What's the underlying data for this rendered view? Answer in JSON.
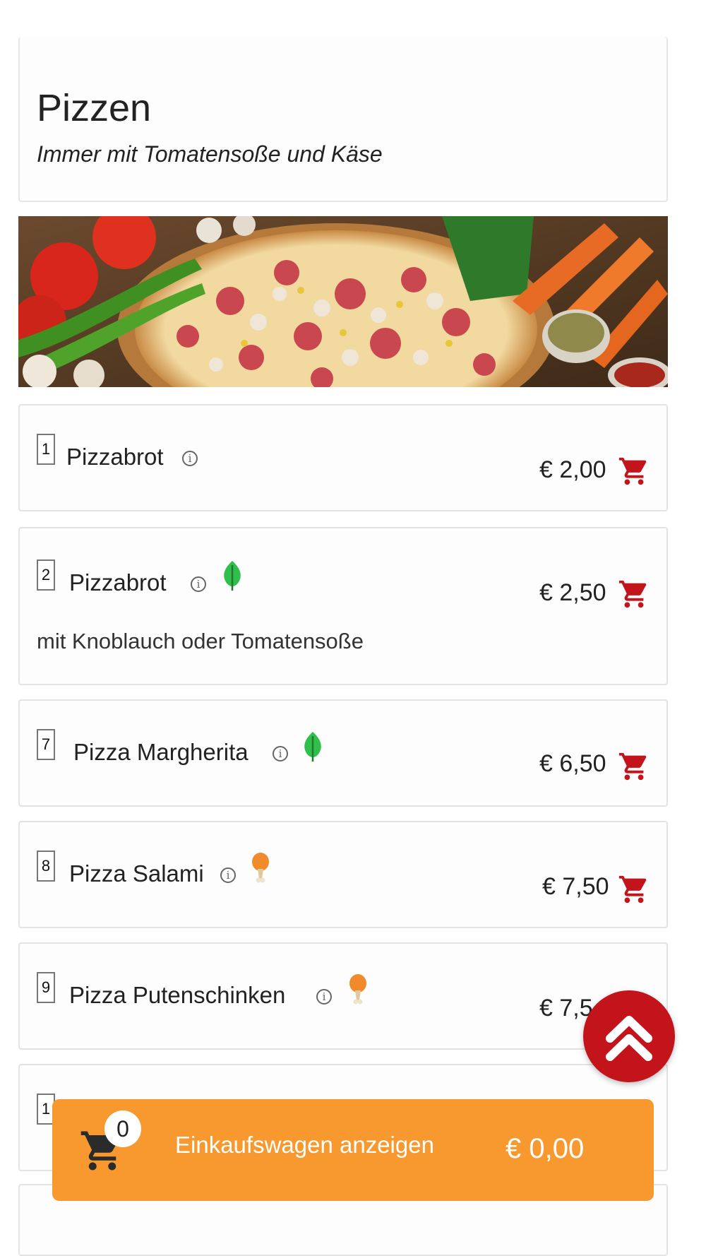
{
  "category": {
    "title": "Pizzen",
    "subtitle": "Immer mit Tomatensoße und Käse"
  },
  "banner": {
    "image": "pizza-with-vegetables-photo"
  },
  "items": [
    {
      "number": "1",
      "name": "Pizzabrot",
      "description": "",
      "diet_icon": "",
      "price": "€ 2,00"
    },
    {
      "number": "2",
      "name": "Pizzabrot",
      "description": "mit Knoblauch oder Tomatensoße",
      "diet_icon": "leaf-icon",
      "price": "€ 2,50"
    },
    {
      "number": "7",
      "name": "Pizza Margherita",
      "description": "",
      "diet_icon": "leaf-icon",
      "price": "€ 6,50"
    },
    {
      "number": "8",
      "name": "Pizza Salami",
      "description": "",
      "diet_icon": "drumstick-icon",
      "price": "€ 7,50"
    },
    {
      "number": "9",
      "name": "Pizza Putenschinken",
      "description": "",
      "diet_icon": "drumstick-icon",
      "price": "€ 7,5"
    },
    {
      "number": "1",
      "name": "",
      "description": "",
      "diet_icon": "",
      "price": ""
    }
  ],
  "cart": {
    "count": "0",
    "label": "Einkaufswagen anzeigen",
    "total": "€ 0,00"
  },
  "colors": {
    "accent_red": "#c4141b",
    "cart_orange": "#f7992e",
    "leaf_green": "#2fbf4a",
    "drumstick_orange": "#f08a2a"
  },
  "icons": {
    "info": "i",
    "scroll_top": "double-chevron-up-icon"
  }
}
